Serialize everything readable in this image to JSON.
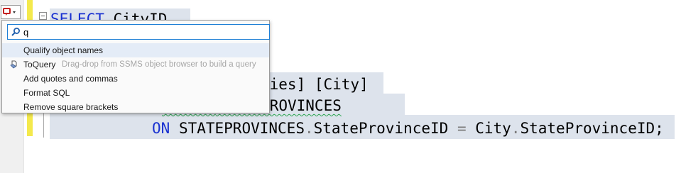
{
  "search": {
    "value": "q"
  },
  "menu": [
    {
      "label": "Qualify object names",
      "hint": ""
    },
    {
      "label": "ToQuery",
      "hint": "Drag-drop from SSMS object browser to build a query"
    },
    {
      "label": "Add quotes and commas",
      "hint": ""
    },
    {
      "label": "Format SQL",
      "hint": ""
    },
    {
      "label": "Remove square brackets",
      "hint": ""
    }
  ],
  "code": {
    "line1_kw": "SELECT",
    "line1_rest": " CityID,",
    "line3_text": "ties] [City]",
    "line4_text": "STATEPROVINCES",
    "line5_kw": "ON",
    "line5_a": "STATEPROVINCES",
    "line5_b": "StateProvinceID",
    "line5_eq": "=",
    "line5_c": "City",
    "line5_d": "StateProvinceID;"
  },
  "colors": {
    "keyword": "#1a32d1",
    "selection": "#dde3ec",
    "change_bar": "#f4e94c",
    "squiggle": "#2aa54f"
  }
}
